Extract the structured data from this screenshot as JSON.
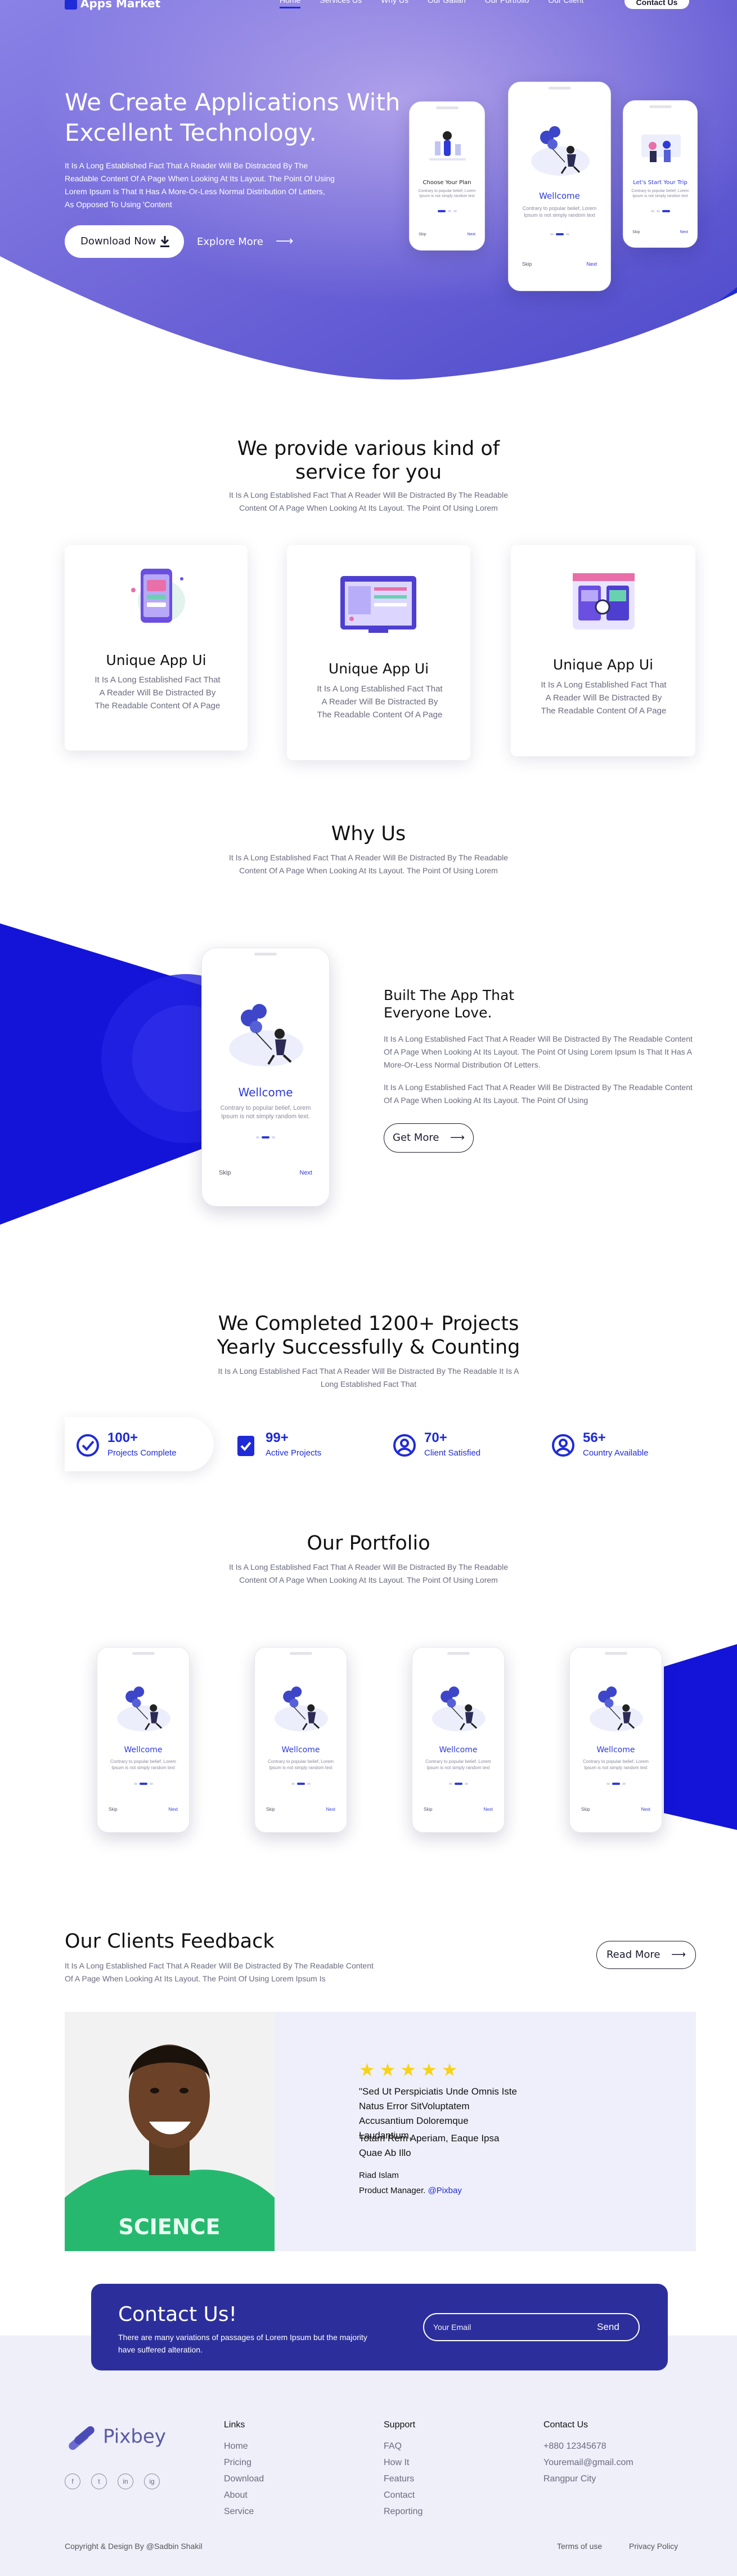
{
  "nav": {
    "logo": "Apps Market",
    "links": [
      "Home",
      "Services Us",
      "Why Us",
      "Our Gallari",
      "Our Portfolio",
      "Our Client"
    ],
    "contact_button": "Contact Us"
  },
  "hero": {
    "title": "We Create Applications With Excellent Technology.",
    "text": "It Is A Long Established Fact That A Reader Will Be Distracted By The Readable Content Of A Page When Looking At Its Layout. The Point Of Using Lorem Ipsum Is That It Has A More-Or-Less Normal Distribution Of Letters, As Opposed To Using 'Content",
    "download_label": "Download Now",
    "explore_label": "Explore More",
    "phones": [
      {
        "title": "Choose Your Plan",
        "text": "Contrary to popular belief, Lorem Ipsum is not simply random text"
      },
      {
        "title": "Wellcome",
        "text": "Contrary to popular belief, Lorem Ipsum is not simply random text",
        "skip": "Skip",
        "next": "Next"
      },
      {
        "title": "Let's Start Your Trip",
        "text": "Contrary to popular belief, Lorem Ipsum is not simply random text"
      }
    ],
    "phone_skip": "Skip",
    "phone_next": "Next"
  },
  "services": {
    "title": "We provide various kind of service for you",
    "subtitle": "It Is A Long Established Fact That A Reader Will Be Distracted By The Readable Content Of A Page When Looking At Its Layout. The Point Of Using Lorem",
    "cards": [
      {
        "title": "Unique App Ui",
        "text": "It Is A Long Established Fact That A Reader Will Be Distracted By The Readable Content Of A Page"
      },
      {
        "title": "Unique App Ui",
        "text": "It Is A Long Established Fact That A Reader Will Be Distracted By The Readable Content Of A Page"
      },
      {
        "title": "Unique App Ui",
        "text": "It Is A Long Established Fact That A Reader Will Be Distracted By The Readable Content Of A Page"
      }
    ]
  },
  "why": {
    "title": "Why Us",
    "subtitle": "It Is A Long Established Fact That A Reader Will Be Distracted By The Readable Content Of A Page When Looking At Its Layout. The Point Of Using Lorem",
    "heading": "Built The App That Everyone Love.",
    "para1": "It Is A Long Established Fact That A Reader Will Be Distracted By The Readable Content Of A Page When Looking At Its Layout. The Point Of Using Lorem Ipsum Is That It Has A More-Or-Less Normal Distribution Of Letters.",
    "para2": "It Is A Long Established Fact That A Reader Will Be Distracted By The Readable Content Of A Page When Looking At Its Layout. The Point Of Using",
    "button": "Get More",
    "phone": {
      "title": "Wellcome",
      "text": "Contrary to popular belief, Lorem Ipsum is not simply random text.",
      "skip": "Skip",
      "next": "Next"
    }
  },
  "stats": {
    "title": "We Completed 1200+ Projects Yearly Successfully & Counting",
    "subtitle": "It Is A Long Established Fact That A Reader Will Be Distracted By The Readable It Is A Long Established Fact That",
    "items": [
      {
        "num": "100+",
        "label": "Projects Complete",
        "icon": "check-circle-icon"
      },
      {
        "num": "99+",
        "label": "Active Projects",
        "icon": "clipboard-check-icon"
      },
      {
        "num": "70+",
        "label": "Client Satisfied",
        "icon": "user-circle-icon"
      },
      {
        "num": "56+",
        "label": "Country Available",
        "icon": "user-circle-icon"
      }
    ]
  },
  "portfolio": {
    "title": "Our Portfolio",
    "subtitle": "It Is A Long Established Fact That A Reader Will Be Distracted By The Readable Content Of A Page When Looking At Its Layout. The Point Of Using Lorem",
    "phone": {
      "title": "Wellcome",
      "text": "Contrary to popular belief, Lorem Ipsum is not simply random text",
      "skip": "Skip",
      "next": "Next"
    }
  },
  "feedback": {
    "title": "Our Clients Feedback",
    "subtitle": "It Is A Long Established Fact That A Reader Will Be Distracted By The Readable Content Of A Page When Looking At Its Layout. The Point Of Using Lorem Ipsum Is",
    "button": "Read More",
    "rating": 5,
    "quote1": "\"Sed Ut Perspiciatis Unde Omnis Iste Natus Error SitVoluptatem Accusantium Doloremque Laudantium,",
    "quote2": "Totam Rem Aperiam, Eaque Ipsa Quae Ab Illo",
    "name": "Riad Islam",
    "role": "Product Manager.",
    "handle": "@Pixbay",
    "shirt": "SCIENCE"
  },
  "contact": {
    "title": "Contact Us!",
    "text": "There are many variations of passages of Lorem Ipsum but the majority have suffered alteration.",
    "email_placeholder": "Your Email",
    "send": "Send"
  },
  "footer": {
    "brand": "Pixbey",
    "links_title": "Links",
    "links": [
      "Home",
      "Pricing",
      "Download",
      "About",
      "Service"
    ],
    "support_title": "Support",
    "support": [
      "FAQ",
      "How It",
      "Featurs",
      "Contact",
      "Reporting"
    ],
    "contact_title": "Contact Us",
    "contact": [
      "+880 12345678",
      "Youremail@gmail.com",
      "Rangpur City"
    ],
    "social": [
      "f",
      "t",
      "in",
      "ig"
    ],
    "copyright": "Copyright & Design By @Sadbin Shakil",
    "terms": "Terms of use",
    "privacy": "Privacy Policy"
  },
  "colors": {
    "primary": "#1f2bd6",
    "hero_overlay": "#6a63d8",
    "contact_box": "#2c2f9b",
    "star": "#f6d31a"
  }
}
